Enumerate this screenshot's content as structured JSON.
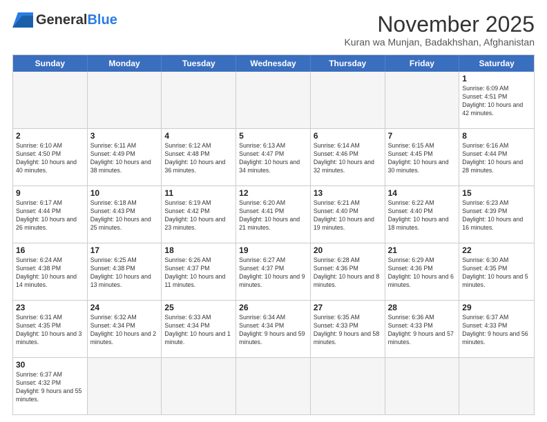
{
  "logo": {
    "text_general": "General",
    "text_blue": "Blue"
  },
  "title": {
    "month_year": "November 2025",
    "subtitle": "Kuran wa Munjan, Badakhshan, Afghanistan"
  },
  "header_days": [
    "Sunday",
    "Monday",
    "Tuesday",
    "Wednesday",
    "Thursday",
    "Friday",
    "Saturday"
  ],
  "rows": [
    [
      {
        "day": "",
        "info": ""
      },
      {
        "day": "",
        "info": ""
      },
      {
        "day": "",
        "info": ""
      },
      {
        "day": "",
        "info": ""
      },
      {
        "day": "",
        "info": ""
      },
      {
        "day": "",
        "info": ""
      },
      {
        "day": "1",
        "info": "Sunrise: 6:09 AM\nSunset: 4:51 PM\nDaylight: 10 hours and 42 minutes."
      }
    ],
    [
      {
        "day": "2",
        "info": "Sunrise: 6:10 AM\nSunset: 4:50 PM\nDaylight: 10 hours and 40 minutes."
      },
      {
        "day": "3",
        "info": "Sunrise: 6:11 AM\nSunset: 4:49 PM\nDaylight: 10 hours and 38 minutes."
      },
      {
        "day": "4",
        "info": "Sunrise: 6:12 AM\nSunset: 4:48 PM\nDaylight: 10 hours and 36 minutes."
      },
      {
        "day": "5",
        "info": "Sunrise: 6:13 AM\nSunset: 4:47 PM\nDaylight: 10 hours and 34 minutes."
      },
      {
        "day": "6",
        "info": "Sunrise: 6:14 AM\nSunset: 4:46 PM\nDaylight: 10 hours and 32 minutes."
      },
      {
        "day": "7",
        "info": "Sunrise: 6:15 AM\nSunset: 4:45 PM\nDaylight: 10 hours and 30 minutes."
      },
      {
        "day": "8",
        "info": "Sunrise: 6:16 AM\nSunset: 4:44 PM\nDaylight: 10 hours and 28 minutes."
      }
    ],
    [
      {
        "day": "9",
        "info": "Sunrise: 6:17 AM\nSunset: 4:44 PM\nDaylight: 10 hours and 26 minutes."
      },
      {
        "day": "10",
        "info": "Sunrise: 6:18 AM\nSunset: 4:43 PM\nDaylight: 10 hours and 25 minutes."
      },
      {
        "day": "11",
        "info": "Sunrise: 6:19 AM\nSunset: 4:42 PM\nDaylight: 10 hours and 23 minutes."
      },
      {
        "day": "12",
        "info": "Sunrise: 6:20 AM\nSunset: 4:41 PM\nDaylight: 10 hours and 21 minutes."
      },
      {
        "day": "13",
        "info": "Sunrise: 6:21 AM\nSunset: 4:40 PM\nDaylight: 10 hours and 19 minutes."
      },
      {
        "day": "14",
        "info": "Sunrise: 6:22 AM\nSunset: 4:40 PM\nDaylight: 10 hours and 18 minutes."
      },
      {
        "day": "15",
        "info": "Sunrise: 6:23 AM\nSunset: 4:39 PM\nDaylight: 10 hours and 16 minutes."
      }
    ],
    [
      {
        "day": "16",
        "info": "Sunrise: 6:24 AM\nSunset: 4:38 PM\nDaylight: 10 hours and 14 minutes."
      },
      {
        "day": "17",
        "info": "Sunrise: 6:25 AM\nSunset: 4:38 PM\nDaylight: 10 hours and 13 minutes."
      },
      {
        "day": "18",
        "info": "Sunrise: 6:26 AM\nSunset: 4:37 PM\nDaylight: 10 hours and 11 minutes."
      },
      {
        "day": "19",
        "info": "Sunrise: 6:27 AM\nSunset: 4:37 PM\nDaylight: 10 hours and 9 minutes."
      },
      {
        "day": "20",
        "info": "Sunrise: 6:28 AM\nSunset: 4:36 PM\nDaylight: 10 hours and 8 minutes."
      },
      {
        "day": "21",
        "info": "Sunrise: 6:29 AM\nSunset: 4:36 PM\nDaylight: 10 hours and 6 minutes."
      },
      {
        "day": "22",
        "info": "Sunrise: 6:30 AM\nSunset: 4:35 PM\nDaylight: 10 hours and 5 minutes."
      }
    ],
    [
      {
        "day": "23",
        "info": "Sunrise: 6:31 AM\nSunset: 4:35 PM\nDaylight: 10 hours and 3 minutes."
      },
      {
        "day": "24",
        "info": "Sunrise: 6:32 AM\nSunset: 4:34 PM\nDaylight: 10 hours and 2 minutes."
      },
      {
        "day": "25",
        "info": "Sunrise: 6:33 AM\nSunset: 4:34 PM\nDaylight: 10 hours and 1 minute."
      },
      {
        "day": "26",
        "info": "Sunrise: 6:34 AM\nSunset: 4:34 PM\nDaylight: 9 hours and 59 minutes."
      },
      {
        "day": "27",
        "info": "Sunrise: 6:35 AM\nSunset: 4:33 PM\nDaylight: 9 hours and 58 minutes."
      },
      {
        "day": "28",
        "info": "Sunrise: 6:36 AM\nSunset: 4:33 PM\nDaylight: 9 hours and 57 minutes."
      },
      {
        "day": "29",
        "info": "Sunrise: 6:37 AM\nSunset: 4:33 PM\nDaylight: 9 hours and 56 minutes."
      }
    ],
    [
      {
        "day": "30",
        "info": "Sunrise: 6:37 AM\nSunset: 4:32 PM\nDaylight: 9 hours and 55 minutes."
      },
      {
        "day": "",
        "info": ""
      },
      {
        "day": "",
        "info": ""
      },
      {
        "day": "",
        "info": ""
      },
      {
        "day": "",
        "info": ""
      },
      {
        "day": "",
        "info": ""
      },
      {
        "day": "",
        "info": ""
      }
    ]
  ]
}
